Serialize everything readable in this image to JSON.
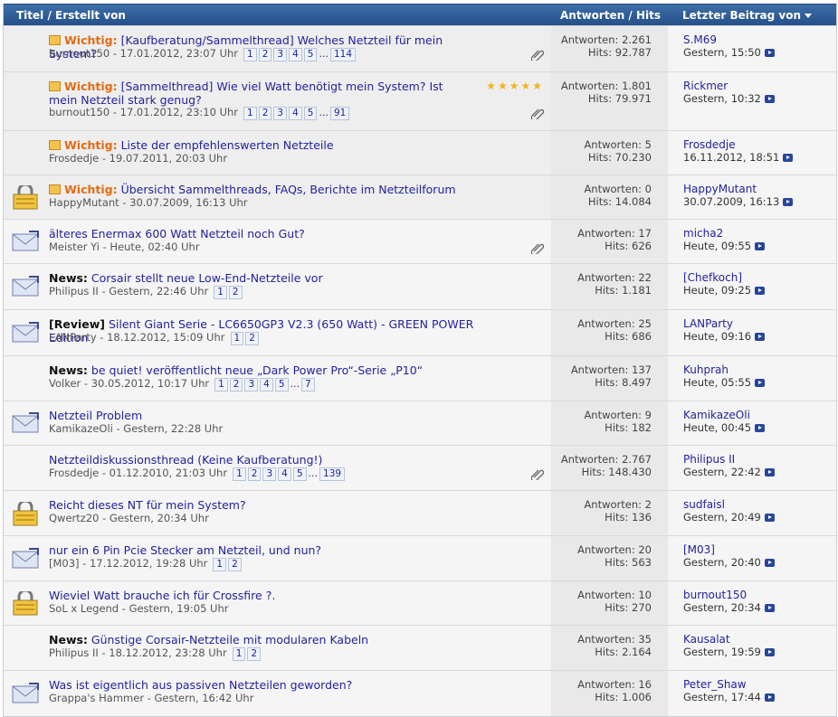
{
  "header": {
    "title_col": "Titel / Erstellt von",
    "stats_col": "Antworten / Hits",
    "last_col": "Letzter Beitrag von"
  },
  "colors": {
    "header_bg": "#2d5a96",
    "link": "#22229c",
    "sticky_prefix": "#e46b11"
  },
  "threads": [
    {
      "icon": "sticky-note-icon",
      "prefix": "Wichtig:",
      "title": "[Kaufberatung/Sammelthread] Welches Netzteil für mein System?",
      "meta": "burnout150 - 17.01.2012, 23:07 Uhr",
      "pages": [
        "1",
        "2",
        "3",
        "4",
        "5",
        "...",
        "114"
      ],
      "replies": "Antworten: 2.261",
      "hits": "Hits: 92.787",
      "last_user": "S.M69",
      "last_date": "Gestern, 15:50",
      "attachment": true
    },
    {
      "icon": "sticky-note-icon",
      "prefix": "Wichtig:",
      "title": "[Sammelthread] Wie viel Watt benötigt mein System? Ist mein Netzteil stark genug?",
      "meta": "burnout150 - 17.01.2012, 23:10 Uhr",
      "pages": [
        "1",
        "2",
        "3",
        "4",
        "5",
        "...",
        "91"
      ],
      "replies": "Antworten: 1.801",
      "hits": "Hits: 79.971",
      "last_user": "Rickmer",
      "last_date": "Gestern, 10:32",
      "attachment": true,
      "rating": "★★★★★"
    },
    {
      "icon": "sticky-note-icon",
      "prefix": "Wichtig:",
      "title": "Liste der empfehlenswerten Netzteile",
      "meta": "Frosdedje - 19.07.2011, 20:03 Uhr",
      "pages": [],
      "replies": "Antworten: 5",
      "hits": "Hits: 70.230",
      "last_user": "Frosdedje",
      "last_date": "16.11.2012, 18:51"
    },
    {
      "icon": "locked-thread-icon",
      "prefix": "Wichtig:",
      "title": "Übersicht Sammelthreads, FAQs, Berichte im Netzteilforum",
      "meta": "HappyMutant - 30.07.2009, 16:13 Uhr",
      "pages": [],
      "replies": "Antworten: 0",
      "hits": "Hits: 14.084",
      "last_user": "HappyMutant",
      "last_date": "30.07.2009, 16:13"
    },
    {
      "icon": "envelope-icon",
      "prefix": "",
      "title": "älteres Enermax 600 Watt Netzteil noch Gut?",
      "meta": "Meister Yi - Heute, 02:40 Uhr",
      "pages": [],
      "replies": "Antworten: 17",
      "hits": "Hits: 626",
      "last_user": "micha2",
      "last_date": "Heute, 09:55",
      "attachment": true
    },
    {
      "icon": "envelope-icon",
      "prefix": "News:",
      "title": "Corsair stellt neue Low-End-Netzteile vor",
      "meta": "Philipus II - Gestern, 22:46 Uhr",
      "pages": [
        "1",
        "2"
      ],
      "replies": "Antworten: 22",
      "hits": "Hits: 1.181",
      "last_user": "[Chefkoch]",
      "last_date": "Heute, 09:25"
    },
    {
      "icon": "envelope-icon",
      "prefix": "[Review]",
      "title": "Silent Giant Serie - LC6650GP3 V2.3 (650 Watt) - GREEN POWER Edition",
      "meta": "LANParty - 18.12.2012, 15:09 Uhr",
      "pages": [
        "1",
        "2"
      ],
      "replies": "Antworten: 25",
      "hits": "Hits: 686",
      "last_user": "LANParty",
      "last_date": "Heute, 09:16"
    },
    {
      "icon": "",
      "prefix": "News:",
      "title": "be quiet! veröffentlicht neue „Dark Power Pro“-Serie „P10“",
      "meta": "Volker - 30.05.2012, 10:17 Uhr",
      "pages": [
        "1",
        "2",
        "3",
        "4",
        "5",
        "...",
        "7"
      ],
      "replies": "Antworten: 137",
      "hits": "Hits: 8.497",
      "last_user": "Kuhprah",
      "last_date": "Heute, 05:55"
    },
    {
      "icon": "envelope-icon",
      "prefix": "",
      "title": "Netzteil Problem",
      "meta": "KamikazeOli - Gestern, 22:28 Uhr",
      "pages": [],
      "replies": "Antworten: 9",
      "hits": "Hits: 182",
      "last_user": "KamikazeOli",
      "last_date": "Heute, 00:45"
    },
    {
      "icon": "",
      "prefix": "",
      "title": "Netzteildiskussionsthread (Keine Kaufberatung!)",
      "meta": "Frosdedje - 01.12.2010, 21:03 Uhr",
      "pages": [
        "1",
        "2",
        "3",
        "4",
        "5",
        "...",
        "139"
      ],
      "replies": "Antworten: 2.767",
      "hits": "Hits: 148.430",
      "last_user": "Philipus II",
      "last_date": "Gestern, 22:42",
      "attachment": true
    },
    {
      "icon": "locked-thread-icon",
      "prefix": "",
      "title": "Reicht dieses NT für mein System?",
      "meta": "Qwertz20 - Gestern, 20:34 Uhr",
      "pages": [],
      "replies": "Antworten: 2",
      "hits": "Hits: 136",
      "last_user": "sudfaisl",
      "last_date": "Gestern, 20:49"
    },
    {
      "icon": "envelope-icon",
      "prefix": "",
      "title": "nur ein 6 Pin Pcie Stecker am Netzteil, und nun?",
      "meta": "[M03] - 17.12.2012, 19:28 Uhr",
      "pages": [
        "1",
        "2"
      ],
      "replies": "Antworten: 20",
      "hits": "Hits: 563",
      "last_user": "[M03]",
      "last_date": "Gestern, 20:40"
    },
    {
      "icon": "locked-thread-icon",
      "prefix": "",
      "title": "Wieviel Watt brauche ich für Crossfire ?.",
      "meta": "SoL x Legend - Gestern, 19:05 Uhr",
      "pages": [],
      "replies": "Antworten: 10",
      "hits": "Hits: 270",
      "last_user": "burnout150",
      "last_date": "Gestern, 20:34"
    },
    {
      "icon": "",
      "prefix": "News:",
      "title": "Günstige Corsair-Netzteile mit modularen Kabeln",
      "meta": "Philipus II - 18.12.2012, 23:28 Uhr",
      "pages": [
        "1",
        "2"
      ],
      "replies": "Antworten: 35",
      "hits": "Hits: 2.164",
      "last_user": "Kausalat",
      "last_date": "Gestern, 19:59"
    },
    {
      "icon": "envelope-icon",
      "prefix": "",
      "title": "Was ist eigentlich aus passiven Netzteilen geworden?",
      "meta": "Grappa's Hammer - Gestern, 16:42 Uhr",
      "pages": [],
      "replies": "Antworten: 16",
      "hits": "Hits: 1.006",
      "last_user": "Peter_Shaw",
      "last_date": "Gestern, 17:44"
    }
  ]
}
